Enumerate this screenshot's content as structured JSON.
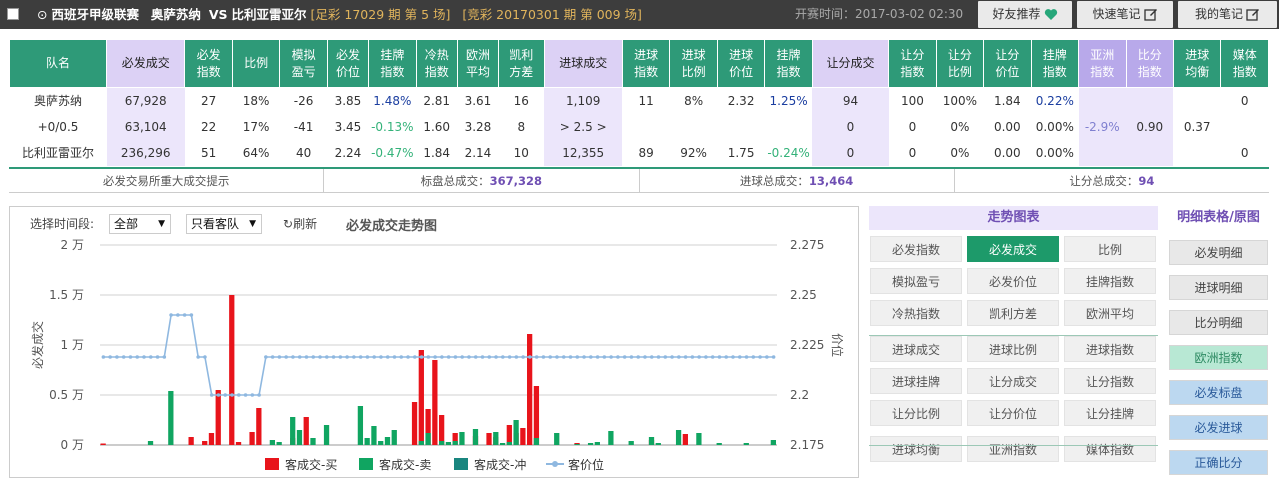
{
  "header": {
    "league": "西班牙甲级联赛",
    "home": "奥萨苏纳",
    "vs": "VS",
    "away": "比利亚雷亚尔",
    "issue1": "[足彩 17029 期 第 5 场]",
    "issue2": "[竞彩 20170301 期 第 009 场]",
    "open_time": "开赛时间：2017-03-02 02:30",
    "btn_friend": "好友推荐",
    "btn_note": "快速笔记",
    "btn_mynote": "我的笔记"
  },
  "table": {
    "headers": [
      {
        "t": "队名",
        "c": ""
      },
      {
        "t": "必发成交",
        "c": "p"
      },
      {
        "t": "必发\n指数",
        "c": ""
      },
      {
        "t": "比例",
        "c": ""
      },
      {
        "t": "模拟\n盈亏",
        "c": ""
      },
      {
        "t": "必发\n价位",
        "c": ""
      },
      {
        "t": "挂牌\n指数",
        "c": ""
      },
      {
        "t": "冷热\n指数",
        "c": ""
      },
      {
        "t": "欧洲\n平均",
        "c": ""
      },
      {
        "t": "凯利\n方差",
        "c": ""
      },
      {
        "t": "进球成交",
        "c": "p"
      },
      {
        "t": "进球\n指数",
        "c": ""
      },
      {
        "t": "进球\n比例",
        "c": ""
      },
      {
        "t": "进球\n价位",
        "c": ""
      },
      {
        "t": "挂牌\n指数",
        "c": ""
      },
      {
        "t": "让分成交",
        "c": "p"
      },
      {
        "t": "让分\n指数",
        "c": ""
      },
      {
        "t": "让分\n比例",
        "c": ""
      },
      {
        "t": "让分\n价位",
        "c": ""
      },
      {
        "t": "挂牌\n指数",
        "c": ""
      },
      {
        "t": "亚洲\n指数",
        "c": "b"
      },
      {
        "t": "比分\n指数",
        "c": "b"
      },
      {
        "t": "进球\n均衡",
        "c": ""
      },
      {
        "t": "媒体\n指数",
        "c": ""
      }
    ],
    "rows": [
      [
        "奥萨苏纳",
        "67,928",
        "27",
        "18%",
        "-26",
        "3.85",
        "1.48%",
        "2.81",
        "3.61",
        "16",
        "1,109",
        "11",
        "8%",
        "2.32",
        "1.25%",
        "94",
        "100",
        "100%",
        "1.84",
        "0.22%",
        "",
        "",
        "",
        "0"
      ],
      [
        "+0/0.5",
        "63,104",
        "22",
        "17%",
        "-41",
        "3.45",
        "-0.13%",
        "1.60",
        "3.28",
        "8",
        "> 2.5 >",
        "",
        "",
        "",
        "",
        "0",
        "0",
        "0%",
        "0.00",
        "0.00%",
        "-2.9%",
        "0.90",
        "0.37",
        ""
      ],
      [
        "比利亚雷亚尔",
        "236,296",
        "51",
        "64%",
        "40",
        "2.24",
        "-0.47%",
        "1.84",
        "2.14",
        "10",
        "12,355",
        "89",
        "92%",
        "1.75",
        "-0.24%",
        "0",
        "0",
        "0%",
        "0.00",
        "0.00%",
        "",
        "",
        "",
        "0"
      ]
    ]
  },
  "summary": {
    "s1": "必发交易所重大成交提示",
    "s2_label": "标盘总成交：",
    "s2_val": "367,328",
    "s3_label": "进球总成交：",
    "s3_val": "13,464",
    "s4_label": "让分总成交：",
    "s4_val": "94"
  },
  "controls": {
    "period_label": "选择时间段:",
    "period_value": "全部",
    "team_value": "只看客队",
    "refresh": "刷新",
    "chart_title": "必发成交走势图"
  },
  "chart_data": {
    "type": "bar+line",
    "ylabel_left": "必发成交",
    "ylabel_right": "价位",
    "yticks_left": [
      "2 万",
      "1.5 万",
      "1 万",
      "0.5 万",
      "0 万"
    ],
    "yticks_right": [
      "2.275",
      "2.25",
      "2.225",
      "2.2",
      "2.175"
    ],
    "ylim_left": [
      0,
      20000
    ],
    "ylim_right": [
      2.175,
      2.275
    ],
    "legend": [
      "客成交-买",
      "客成交-卖",
      "客成交-冲",
      "客价位"
    ],
    "colors": {
      "buy": "#e8141b",
      "sell": "#10a561",
      "flush": "#19867f",
      "price": "#8fb8e0"
    },
    "buy": [
      150,
      0,
      0,
      0,
      0,
      0,
      0,
      0,
      0,
      0,
      0,
      0,
      0,
      800,
      0,
      400,
      1200,
      5500,
      0,
      15000,
      300,
      0,
      1300,
      3700,
      0,
      0,
      0,
      0,
      700,
      0,
      2800,
      0,
      0,
      0,
      0,
      0,
      0,
      0,
      0,
      0,
      0,
      0,
      0,
      0,
      0,
      0,
      4300,
      9500,
      3600,
      8500,
      3000,
      0,
      1200,
      0,
      0,
      900,
      0,
      1200,
      800,
      0,
      2000,
      1200,
      1700,
      11100,
      5900,
      0,
      0,
      0,
      0,
      0,
      200,
      0,
      0,
      0,
      0,
      0,
      0,
      0,
      0,
      0,
      0,
      500,
      0,
      0,
      0,
      0,
      1100,
      0,
      0,
      0,
      0,
      0,
      0,
      0,
      0,
      0,
      0,
      0,
      0,
      0
    ],
    "sell": [
      0,
      0,
      0,
      0,
      0,
      0,
      0,
      400,
      0,
      0,
      5400,
      0,
      0,
      0,
      0,
      0,
      0,
      0,
      0,
      0,
      0,
      0,
      0,
      0,
      0,
      500,
      300,
      0,
      2800,
      1500,
      0,
      700,
      0,
      2000,
      0,
      0,
      0,
      0,
      3900,
      700,
      1900,
      400,
      800,
      1500,
      0,
      0,
      0,
      400,
      1200,
      0,
      400,
      300,
      400,
      1300,
      0,
      1600,
      0,
      0,
      1300,
      200,
      300,
      2500,
      0,
      0,
      700,
      0,
      0,
      1200,
      0,
      0,
      100,
      0,
      200,
      300,
      0,
      1400,
      0,
      0,
      400,
      0,
      0,
      800,
      200,
      0,
      0,
      1500,
      0,
      0,
      1200,
      0,
      0,
      200,
      0,
      0,
      0,
      200,
      0,
      0,
      0,
      500
    ],
    "flush": [],
    "price": [
      2.219,
      2.219,
      2.219,
      2.219,
      2.219,
      2.219,
      2.219,
      2.219,
      2.219,
      2.219,
      2.24,
      2.24,
      2.24,
      2.24,
      2.219,
      2.219,
      2.2,
      2.2,
      2.2,
      2.2,
      2.2,
      2.2,
      2.2,
      2.2,
      2.219,
      2.219,
      2.219,
      2.219,
      2.219,
      2.219,
      2.219,
      2.219,
      2.219,
      2.219,
      2.219,
      2.219,
      2.219,
      2.219,
      2.219,
      2.219,
      2.219,
      2.219,
      2.219,
      2.219,
      2.219,
      2.219,
      2.219,
      2.219,
      2.219,
      2.219,
      2.219,
      2.219,
      2.219,
      2.219,
      2.219,
      2.219,
      2.219,
      2.219,
      2.219,
      2.219,
      2.219,
      2.219,
      2.219,
      2.219,
      2.219,
      2.219,
      2.219,
      2.219,
      2.219,
      2.219,
      2.219,
      2.219,
      2.219,
      2.219,
      2.219,
      2.219,
      2.219,
      2.219,
      2.219,
      2.219,
      2.219,
      2.219,
      2.219,
      2.219,
      2.219,
      2.219,
      2.219,
      2.219,
      2.219,
      2.219,
      2.219,
      2.219,
      2.219,
      2.219,
      2.219,
      2.219,
      2.219,
      2.219,
      2.219,
      2.219
    ]
  },
  "trend_panel": {
    "title": "走势图表",
    "buttons": [
      "必发指数",
      "必发成交",
      "比例",
      "模拟盈亏",
      "必发价位",
      "挂牌指数",
      "冷热指数",
      "凯利方差",
      "欧洲平均",
      "进球成交",
      "进球比例",
      "进球指数",
      "进球挂牌",
      "让分成交",
      "让分指数",
      "让分比例",
      "让分价位",
      "让分挂牌",
      "进球均衡",
      "亚洲指数",
      "媒体指数"
    ],
    "active": "必发成交"
  },
  "detail_panel": {
    "title": "明细表格/原图",
    "buttons": [
      "必发明细",
      "进球明细",
      "比分明细",
      "欧洲指数",
      "必发标盘",
      "必发进球",
      "正确比分"
    ]
  }
}
